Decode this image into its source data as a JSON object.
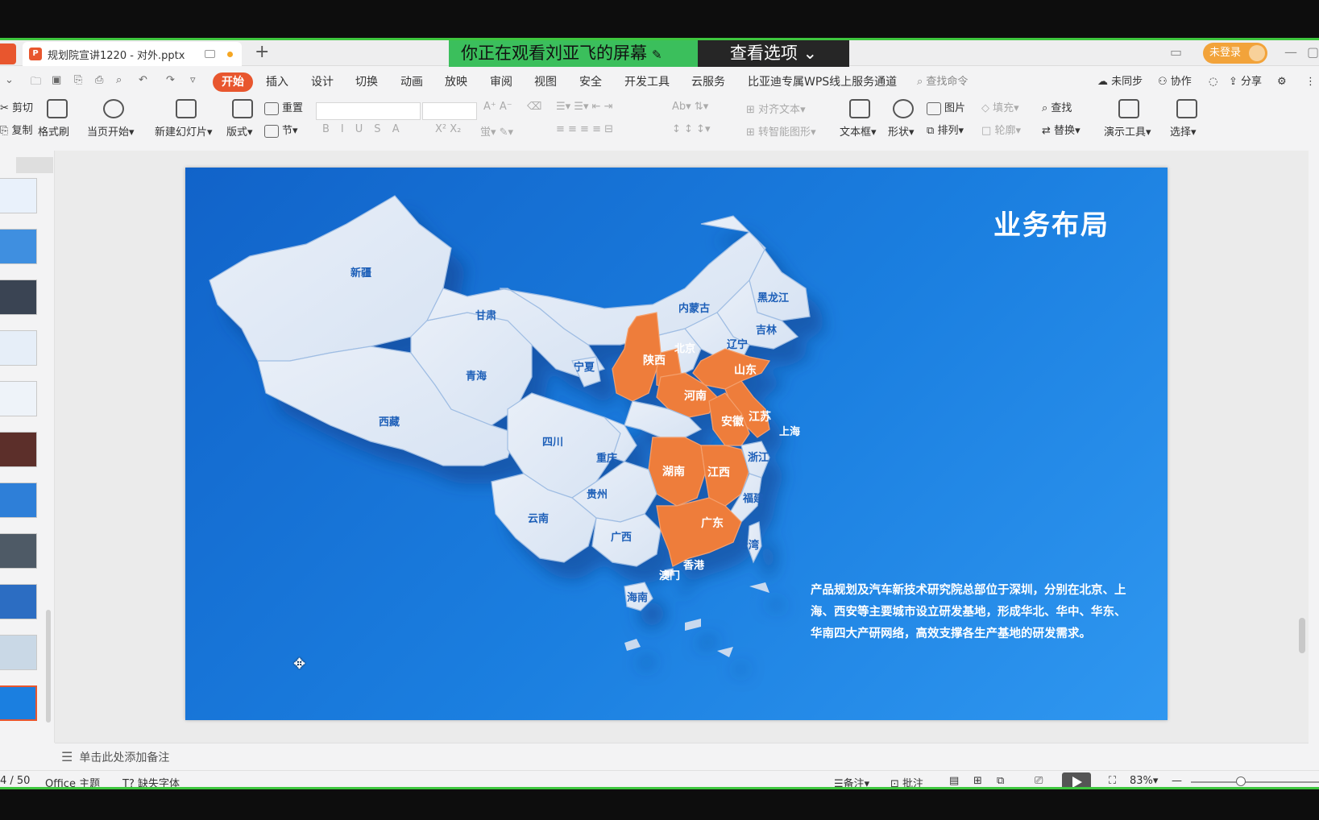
{
  "tabbar": {
    "doc_title": "规划院宣讲1220 - 对外.pptx",
    "share_banner": "你正在观看刘亚飞的屏幕",
    "view_options": "查看选项",
    "login_label": "未登录"
  },
  "menu": {
    "items": [
      "开始",
      "插入",
      "设计",
      "切换",
      "动画",
      "放映",
      "审阅",
      "视图",
      "安全",
      "开发工具",
      "云服务",
      "比亚迪专属WPS线上服务通道"
    ],
    "active": "开始",
    "search_placeholder": "查找命令",
    "right": [
      "未同步",
      "协作",
      "分享"
    ]
  },
  "ribbon": {
    "cut": "剪切",
    "copy": "复制",
    "format_painter": "格式刷",
    "start_from_current": "当页开始",
    "new_slide": "新建幻灯片",
    "layout": "版式",
    "reset": "重置",
    "section": "节",
    "align_text": "对齐文本",
    "smart_shape": "转智能图形",
    "text_box": "文本框",
    "shape": "形状",
    "picture": "图片",
    "arrange": "排列",
    "fill": "填充",
    "outline": "轮廓",
    "find": "查找",
    "replace": "替换",
    "presentation_tools": "演示工具",
    "select": "选择"
  },
  "slide": {
    "title": "业务布局",
    "description": "产品规划及汽车新技术研究院总部位于深圳，分别在北京、上海、西安等主要城市设立研发基地，形成华北、华中、华东、华南四大产研网络，高效支撑各生产基地的研发需求。",
    "provinces": [
      "新疆",
      "西藏",
      "青海",
      "甘肃",
      "内蒙古",
      "黑龙江",
      "吉林",
      "辽宁",
      "北京",
      "宁夏",
      "陕西",
      "山东",
      "河南",
      "安徽",
      "江苏",
      "上海",
      "四川",
      "重庆",
      "湖南",
      "江西",
      "浙江",
      "贵州",
      "云南",
      "广西",
      "广东",
      "福建",
      "台湾",
      "香港",
      "澳门",
      "海南"
    ],
    "highlighted": [
      "陕西",
      "山西",
      "山东",
      "河南",
      "安徽",
      "江苏",
      "湖南",
      "江西",
      "广东"
    ],
    "colors": {
      "highlight": "#ee7d3b",
      "land": "#e4ecf7",
      "background": "#1b7fe0"
    }
  },
  "notes": {
    "placeholder": "单击此处添加备注"
  },
  "status": {
    "slide_counter": "4 / 50",
    "theme": "Office 主题",
    "missing_fonts": "缺失字体",
    "notes_btn": "备注",
    "comments_btn": "批注",
    "zoom": "83%",
    "zoom_fraction": 0.62
  }
}
